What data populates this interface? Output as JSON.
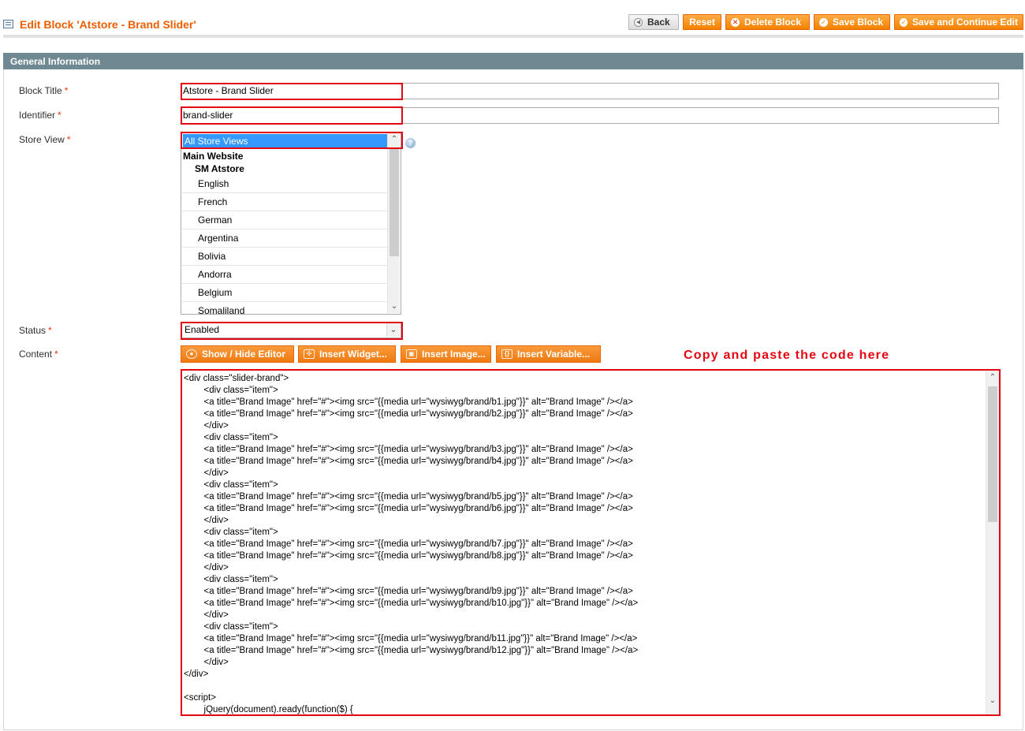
{
  "header": {
    "title": "Edit Block 'Atstore - Brand Slider'",
    "buttons": {
      "back": "Back",
      "reset": "Reset",
      "delete": "Delete Block",
      "save": "Save Block",
      "save_continue": "Save and Continue Edit"
    }
  },
  "section": {
    "title": "General Information"
  },
  "fields": {
    "block_title": {
      "label": "Block Title",
      "value": "Atstore - Brand Slider"
    },
    "identifier": {
      "label": "Identifier",
      "value": "brand-slider"
    },
    "store_view": {
      "label": "Store View",
      "selected": "All Store Views",
      "group": "Main Website",
      "subgroup": "SM Atstore",
      "options": [
        "English",
        "French",
        "German",
        "Argentina",
        "Bolivia",
        "Andorra",
        "Belgium",
        "Somaliland"
      ]
    },
    "status": {
      "label": "Status",
      "value": "Enabled"
    },
    "content": {
      "label": "Content"
    }
  },
  "required_marker": "*",
  "editor_buttons": {
    "show_hide": "Show / Hide Editor",
    "insert_widget": "Insert Widget...",
    "insert_image": "Insert Image...",
    "insert_variable": "Insert Variable..."
  },
  "annotation": "Copy and paste the code here",
  "content_code": [
    "<div class=\"slider-brand\">",
    "        <div class=\"item\">",
    "        <a title=\"Brand Image\" href=\"#\"><img src=\"{{media url=\"wysiwyg/brand/b1.jpg\"}}\" alt=\"Brand Image\" /></a>",
    "        <a title=\"Brand Image\" href=\"#\"><img src=\"{{media url=\"wysiwyg/brand/b2.jpg\"}}\" alt=\"Brand Image\" /></a>",
    "        </div>",
    "        <div class=\"item\">",
    "        <a title=\"Brand Image\" href=\"#\"><img src=\"{{media url=\"wysiwyg/brand/b3.jpg\"}}\" alt=\"Brand Image\" /></a>",
    "        <a title=\"Brand Image\" href=\"#\"><img src=\"{{media url=\"wysiwyg/brand/b4.jpg\"}}\" alt=\"Brand Image\" /></a>",
    "        </div>",
    "        <div class=\"item\">",
    "        <a title=\"Brand Image\" href=\"#\"><img src=\"{{media url=\"wysiwyg/brand/b5.jpg\"}}\" alt=\"Brand Image\" /></a>",
    "        <a title=\"Brand Image\" href=\"#\"><img src=\"{{media url=\"wysiwyg/brand/b6.jpg\"}}\" alt=\"Brand Image\" /></a>",
    "        </div>",
    "        <div class=\"item\">",
    "        <a title=\"Brand Image\" href=\"#\"><img src=\"{{media url=\"wysiwyg/brand/b7.jpg\"}}\" alt=\"Brand Image\" /></a>",
    "        <a title=\"Brand Image\" href=\"#\"><img src=\"{{media url=\"wysiwyg/brand/b8.jpg\"}}\" alt=\"Brand Image\" /></a>",
    "        </div>",
    "        <div class=\"item\">",
    "        <a title=\"Brand Image\" href=\"#\"><img src=\"{{media url=\"wysiwyg/brand/b9.jpg\"}}\" alt=\"Brand Image\" /></a>",
    "        <a title=\"Brand Image\" href=\"#\"><img src=\"{{media url=\"wysiwyg/brand/b10.jpg\"}}\" alt=\"Brand Image\" /></a>",
    "        </div>",
    "        <div class=\"item\">",
    "        <a title=\"Brand Image\" href=\"#\"><img src=\"{{media url=\"wysiwyg/brand/b11.jpg\"}}\" alt=\"Brand Image\" /></a>",
    "        <a title=\"Brand Image\" href=\"#\"><img src=\"{{media url=\"wysiwyg/brand/b12.jpg\"}}\" alt=\"Brand Image\" /></a>",
    "        </div>",
    "</div>",
    "",
    "<script>",
    "        jQuery(document).ready(function($) {"
  ],
  "colors": {
    "accent": "#eb5e00",
    "button_orange": "#f18200",
    "section_bar": "#6f8992",
    "highlight": "#e30613"
  }
}
